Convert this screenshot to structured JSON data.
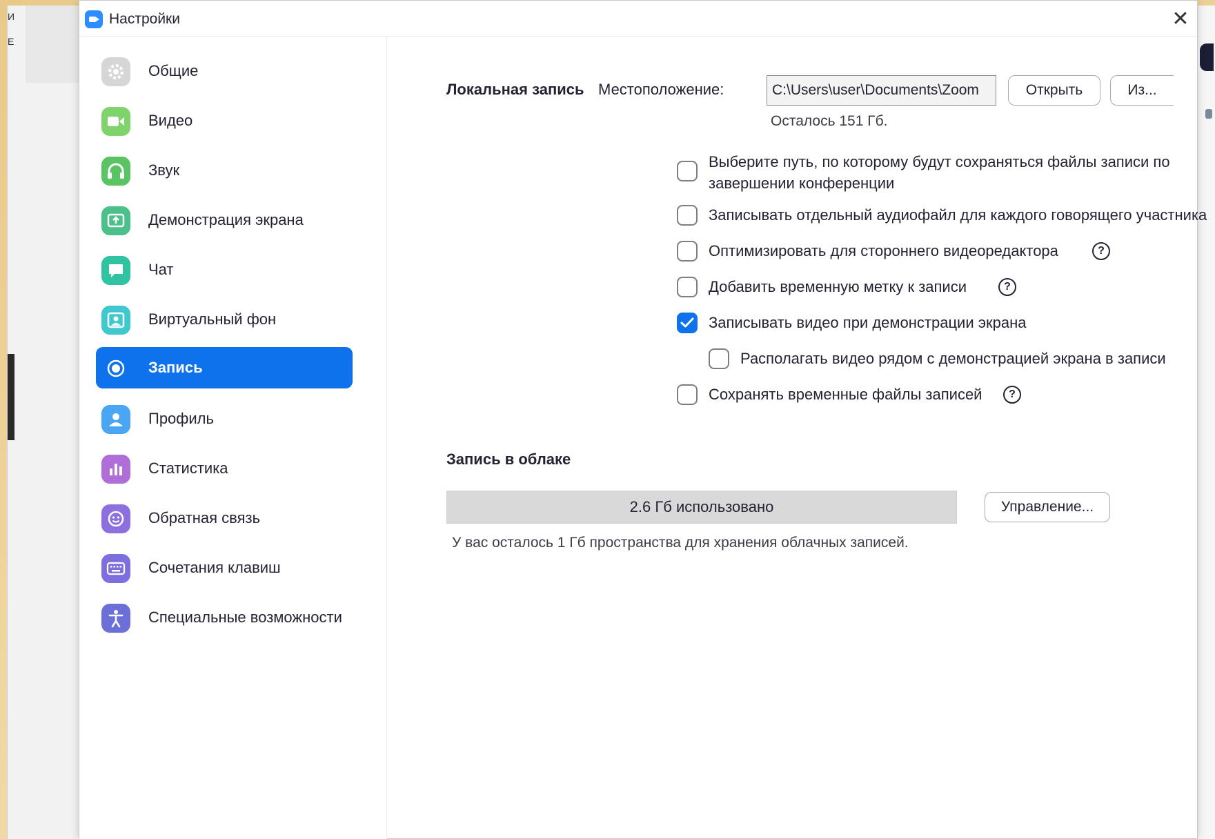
{
  "window": {
    "title": "Настройки",
    "close_glyph": "✕"
  },
  "background": {
    "items": [
      "И",
      "Е"
    ]
  },
  "sidebar": {
    "items": [
      {
        "id": "general",
        "label": "Общие",
        "icon": "gear-icon",
        "color": "#d6d6d6",
        "active": false
      },
      {
        "id": "video",
        "label": "Видео",
        "icon": "camera-icon",
        "color": "#7ed36b",
        "active": false
      },
      {
        "id": "audio",
        "label": "Звук",
        "icon": "headphones-icon",
        "color": "#5ac364",
        "active": false
      },
      {
        "id": "screen-share",
        "label": "Демонстрация экрана",
        "icon": "share-screen-icon",
        "color": "#4cc08a",
        "active": false
      },
      {
        "id": "chat",
        "label": "Чат",
        "icon": "chat-bubble-icon",
        "color": "#2fc3a2",
        "active": false
      },
      {
        "id": "virtual-bg",
        "label": "Виртуальный фон",
        "icon": "portrait-icon",
        "color": "#3fc9cf",
        "active": false
      },
      {
        "id": "recording",
        "label": "Запись",
        "icon": "record-icon",
        "color": "#0e72ed",
        "active": true
      },
      {
        "id": "profile",
        "label": "Профиль",
        "icon": "user-icon",
        "color": "#4aa6f2",
        "active": false
      },
      {
        "id": "statistics",
        "label": "Статистика",
        "icon": "bar-chart-icon",
        "color": "#b06ed8",
        "active": false
      },
      {
        "id": "feedback",
        "label": "Обратная связь",
        "icon": "smiley-icon",
        "color": "#8e6fe0",
        "active": false
      },
      {
        "id": "shortcuts",
        "label": "Сочетания клавиш",
        "icon": "keyboard-icon",
        "color": "#7d6fe0",
        "active": false
      },
      {
        "id": "accessibility",
        "label": "Специальные возможности",
        "icon": "accessibility-icon",
        "color": "#6c6fd8",
        "active": false
      }
    ]
  },
  "local_recording": {
    "title": "Локальная запись",
    "location_label": "Местоположение:",
    "location_value": "C:\\Users\\user\\Documents\\Zoom",
    "open_button": "Открыть",
    "change_button": "Из...",
    "space_left": "Осталось 151 Гб.",
    "options": [
      {
        "label_line1": "Выберите путь, по которому будут сохраняться файлы записи по",
        "label_line2": "завершении конференции",
        "checked": false,
        "help": false
      },
      {
        "label_line1": "Записывать отдельный аудиофайл для каждого говорящего участника",
        "checked": false,
        "help": false
      },
      {
        "label_line1": "Оптимизировать для стороннего видеоредактора",
        "checked": false,
        "help": true
      },
      {
        "label_line1": "Добавить временную метку к записи",
        "checked": false,
        "help": true
      },
      {
        "label_line1": "Записывать видео при демонстрации экрана",
        "checked": true,
        "help": false
      },
      {
        "label_line1": "Располагать видео рядом с демонстрацией экрана в записи",
        "checked": false,
        "help": false
      },
      {
        "label_line1": "Сохранять временные файлы записей",
        "checked": false,
        "help": true
      }
    ],
    "help_glyph": "?"
  },
  "cloud_recording": {
    "title": "Запись в облаке",
    "used_text": "2.6 Гб использовано",
    "manage_button": "Управление...",
    "remaining_text": "У вас осталось 1 Гб пространства для хранения облачных записей."
  },
  "colors": {
    "accent": "#0e72ed",
    "text": "#232333"
  }
}
